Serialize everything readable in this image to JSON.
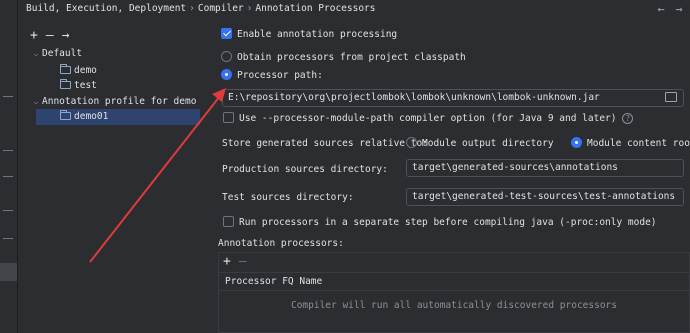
{
  "breadcrumb": {
    "items": [
      "Build, Execution, Deployment",
      "Compiler",
      "Annotation Processors"
    ],
    "separator": "›"
  },
  "nav": {
    "back_icon": "←",
    "forward_icon": "→"
  },
  "tree_toolbar": {
    "add": "+",
    "remove": "—",
    "move": "→"
  },
  "tree": {
    "default_label": "Default",
    "default_children": [
      "demo",
      "test"
    ],
    "profile_label": "Annotation profile for demo",
    "profile_children": [
      "demo01"
    ],
    "expanded_icon": "⌵"
  },
  "settings": {
    "enable_label": "Enable annotation processing",
    "enable_checked": true,
    "obtain_label": "Obtain processors from project classpath",
    "processor_path_label": "Processor path:",
    "selected_source": "processor_path",
    "processor_path_value": "E:\\repository\\org\\projectlombok\\lombok\\unknown\\lombok-unknown.jar",
    "module_path_label": "Use --processor-module-path compiler option (for Java 9 and later)",
    "help_icon": "?",
    "store_label": "Store generated sources relative to:",
    "module_output_label": "Module output directory",
    "module_content_label": "Module content root",
    "store_selected": "module_content_root",
    "production_label": "Production sources directory:",
    "production_value": "target\\generated-sources\\annotations",
    "test_label": "Test sources directory:",
    "test_value": "target\\generated-test-sources\\test-annotations",
    "separate_step_label": "Run processors in a separate step before compiling java (-proc:only mode)",
    "processors_label": "Annotation processors:"
  },
  "processors_table": {
    "add": "+",
    "remove": "—",
    "column_header": "Processor FQ Name",
    "empty_text": "Compiler will run all automatically discovered processors"
  },
  "colors": {
    "accent": "#3574f0",
    "arrow": "#e03a3a",
    "background": "#2b2d30",
    "selection": "#2e436e"
  }
}
